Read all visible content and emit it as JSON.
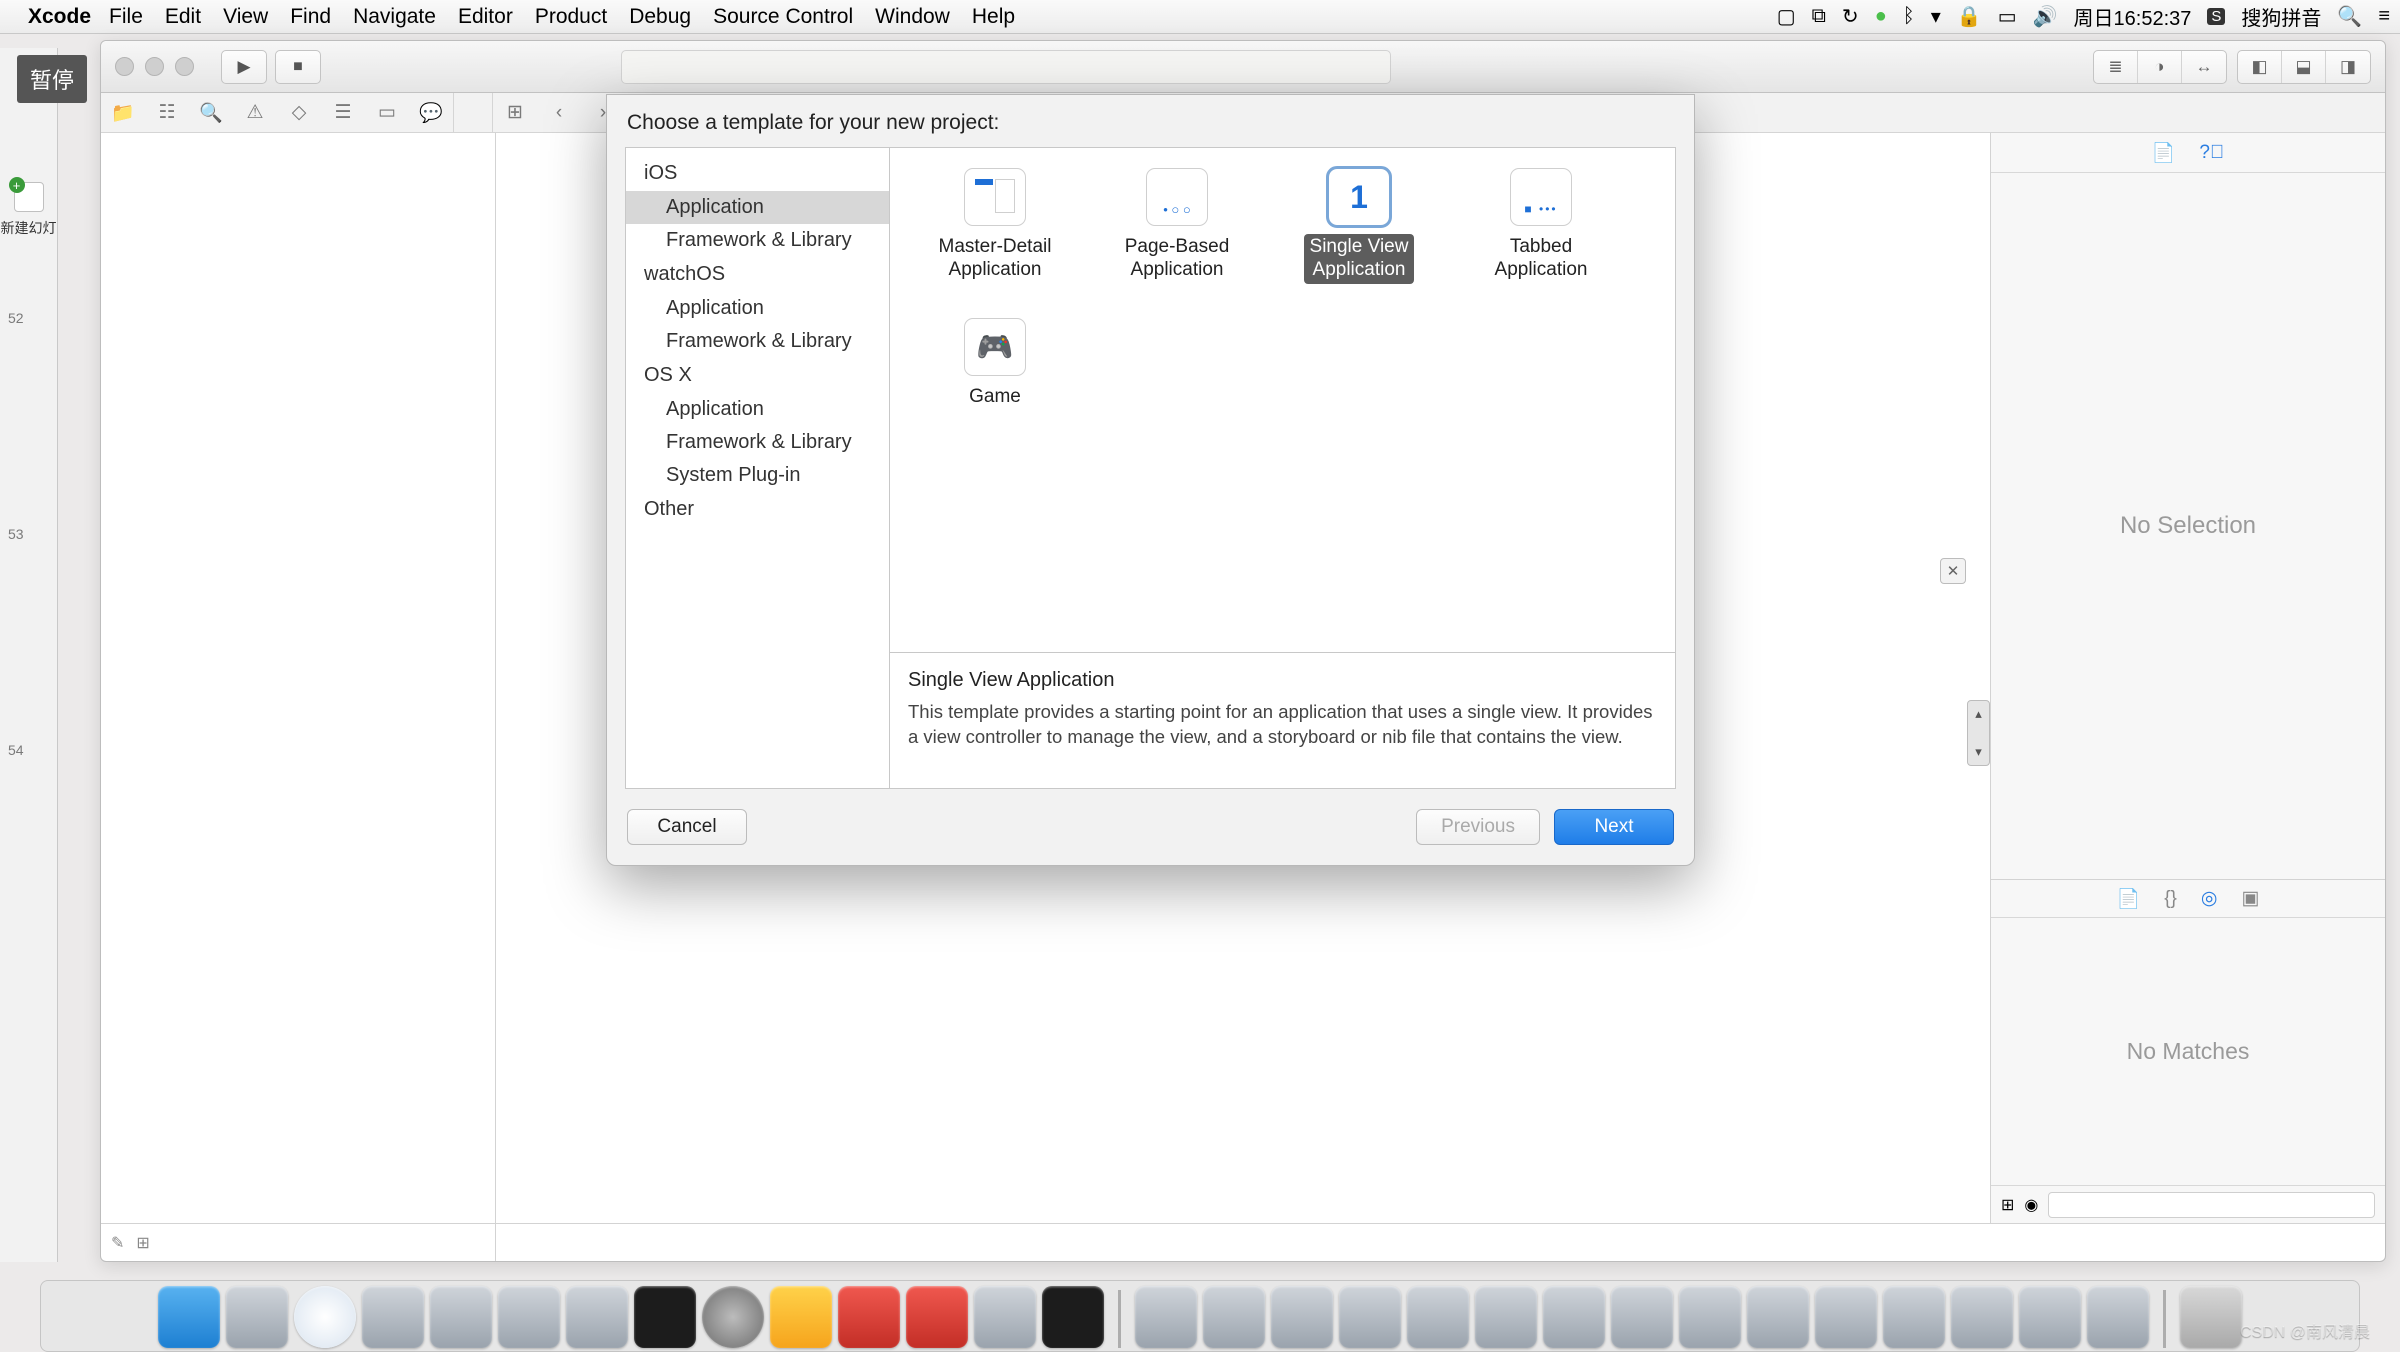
{
  "menubar": {
    "app": "Xcode",
    "items": [
      "File",
      "Edit",
      "View",
      "Find",
      "Navigate",
      "Editor",
      "Product",
      "Debug",
      "Source Control",
      "Window",
      "Help"
    ],
    "clock": "周日16:52:37",
    "ime": "搜狗拼音"
  },
  "overlay": {
    "pause": "暂停"
  },
  "leftapp": {
    "new_label": "新建幻灯",
    "lines": [
      "52",
      "53",
      "54"
    ]
  },
  "toolbar": {
    "run_glyph": "▶",
    "stop_glyph": "■"
  },
  "navigator_tabs": [
    "folder",
    "hierarchy",
    "search",
    "warn",
    "tag",
    "stack",
    "frame",
    "chat"
  ],
  "inspector": {
    "nosel": "No Selection",
    "nomatch": "No Matches",
    "filter_placeholder": ""
  },
  "sheet": {
    "title": "Choose a template for your new project:",
    "sidebar": [
      {
        "type": "sec",
        "label": "iOS"
      },
      {
        "type": "itm",
        "label": "Application",
        "selected": true
      },
      {
        "type": "itm",
        "label": "Framework & Library"
      },
      {
        "type": "sec",
        "label": "watchOS"
      },
      {
        "type": "itm",
        "label": "Application"
      },
      {
        "type": "itm",
        "label": "Framework & Library"
      },
      {
        "type": "sec",
        "label": "OS X"
      },
      {
        "type": "itm",
        "label": "Application"
      },
      {
        "type": "itm",
        "label": "Framework & Library"
      },
      {
        "type": "itm",
        "label": "System Plug-in"
      },
      {
        "type": "sec",
        "label": "Other"
      }
    ],
    "templates": [
      {
        "id": "masterdetail",
        "label": "Master-Detail\nApplication"
      },
      {
        "id": "pagebased",
        "label": "Page-Based\nApplication"
      },
      {
        "id": "single",
        "label": "Single View\nApplication",
        "selected": true,
        "glyph": "1"
      },
      {
        "id": "tabbed",
        "label": "Tabbed\nApplication"
      },
      {
        "id": "game",
        "label": "Game",
        "glyph": "🎮"
      }
    ],
    "desc": {
      "title": "Single View Application",
      "body": "This template provides a starting point for an application that uses a single view. It provides a view controller to manage the view, and a storyboard or nib file that contains the view."
    },
    "buttons": {
      "cancel": "Cancel",
      "previous": "Previous",
      "next": "Next"
    }
  },
  "watermark": "CSDN @南风清晨"
}
